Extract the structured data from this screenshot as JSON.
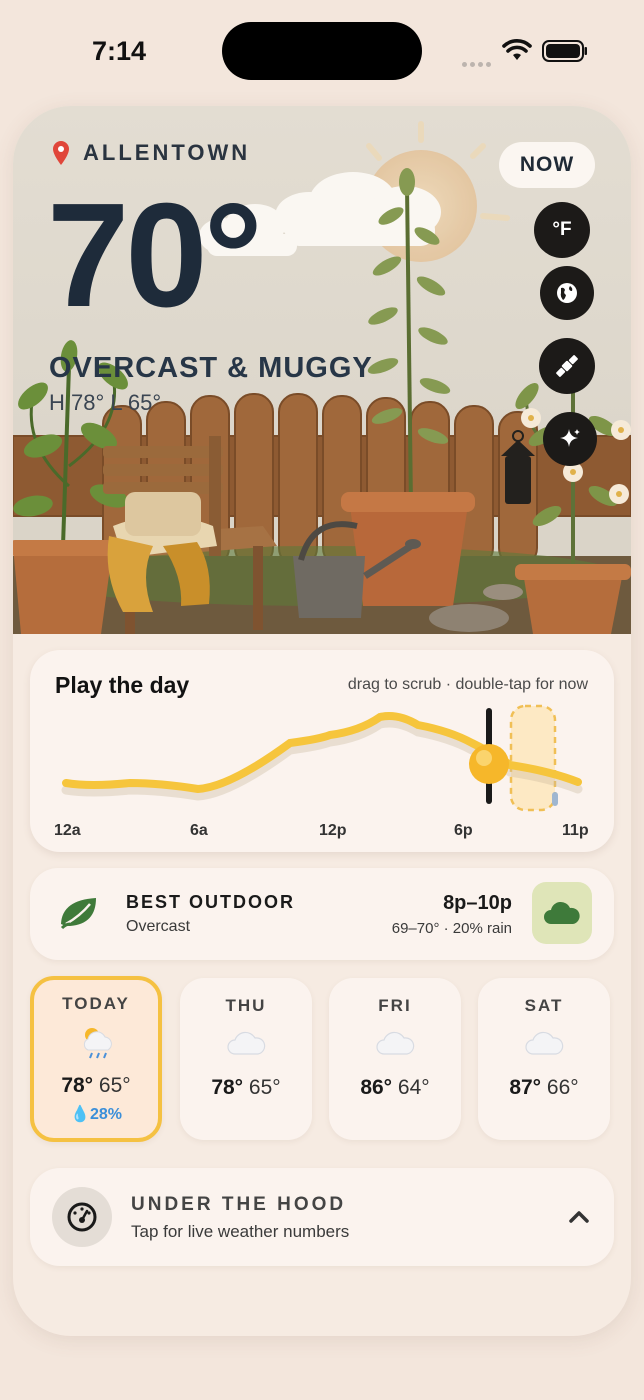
{
  "status_bar": {
    "time": "7:14"
  },
  "hero": {
    "location": "ALLENTOWN",
    "temperature": "70°",
    "condition": "OVERCAST & MUGGY",
    "hi_lo": "H 78°   L 65°",
    "now_label": "NOW",
    "unit_label": "°F",
    "buttons": [
      "globe-icon",
      "satellite-icon",
      "sparkle-icon"
    ]
  },
  "play": {
    "title": "Play the day",
    "hint": "drag to scrub · double-tap for now",
    "ticks": [
      "12a",
      "6a",
      "12p",
      "6p",
      "11p"
    ]
  },
  "best_outdoor": {
    "label": "BEST OUTDOOR",
    "condition": "Overcast",
    "time_range": "8p–10p",
    "detail": "69–70° · 20% rain"
  },
  "forecast": [
    {
      "day": "TODAY",
      "hi": "78°",
      "lo": "65°",
      "rain": "💧28%",
      "icon": "rain-sun-icon"
    },
    {
      "day": "THU",
      "hi": "78°",
      "lo": "65°",
      "icon": "cloud-icon"
    },
    {
      "day": "FRI",
      "hi": "86°",
      "lo": "64°",
      "icon": "cloud-icon"
    },
    {
      "day": "SAT",
      "hi": "87°",
      "lo": "66°",
      "icon": "cloud-icon"
    }
  ],
  "hood": {
    "label": "UNDER THE HOOD",
    "subtitle": "Tap for live weather numbers"
  },
  "colors": {
    "accent": "#f5c142",
    "rain": "#3b8fd9",
    "ink": "#1e2b3a"
  }
}
